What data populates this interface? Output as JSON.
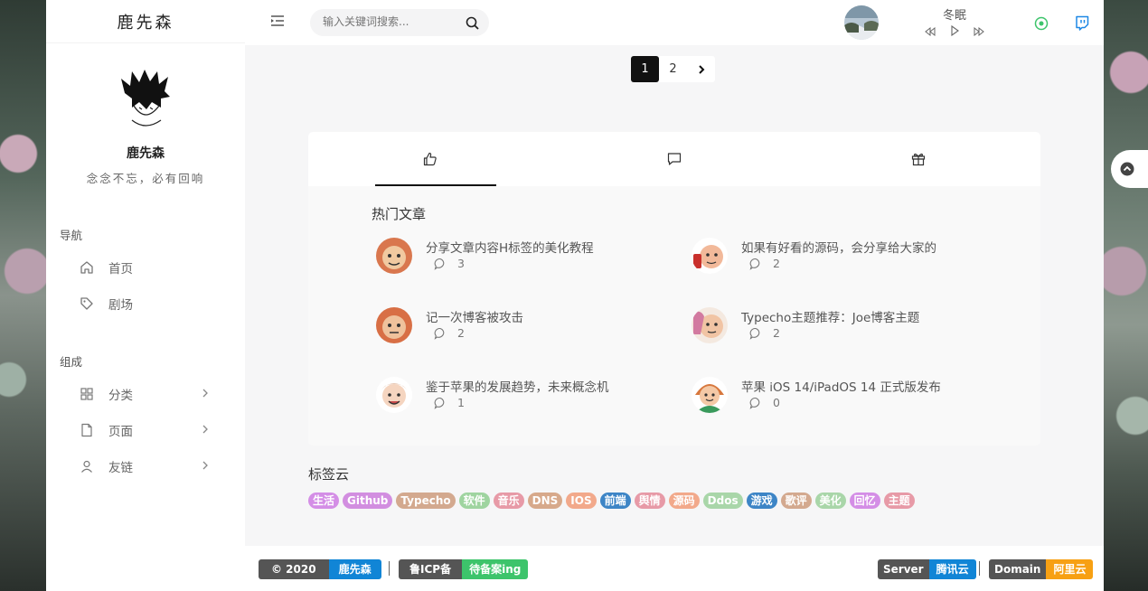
{
  "site": {
    "logo_text": "鹿先森",
    "nickname": "鹿先森",
    "motto": "念念不忘，必有回响"
  },
  "nav": {
    "section1": "导航",
    "section2": "组成",
    "items": [
      {
        "label": "首页",
        "icon": "home-icon"
      },
      {
        "label": "剧场",
        "icon": "tag-icon"
      },
      {
        "label": "分类",
        "icon": "grid-icon"
      },
      {
        "label": "页面",
        "icon": "file-icon"
      },
      {
        "label": "友链",
        "icon": "user-icon"
      }
    ]
  },
  "search": {
    "placeholder": "输入关键词搜索..."
  },
  "player": {
    "song": "冬眠"
  },
  "pagination": {
    "pages": [
      "1",
      "2"
    ],
    "current": "1"
  },
  "hot": {
    "title": "热门文章",
    "posts": [
      {
        "title": "分享文章内容H标签的美化教程",
        "comments": "3"
      },
      {
        "title": "如果有好看的源码，会分享给大家的",
        "comments": "2"
      },
      {
        "title": "记一次博客被攻击",
        "comments": "2"
      },
      {
        "title": "Typecho主题推荐：Joe博客主题",
        "comments": "2"
      },
      {
        "title": "鉴于苹果的发展趋势，未来概念机",
        "comments": "1"
      },
      {
        "title": "苹果 iOS 14/iPadOS 14 正式版发布",
        "comments": "0"
      }
    ]
  },
  "tag_cloud": {
    "title": "标签云",
    "tags": [
      {
        "label": "生活",
        "color": "#d48ee6"
      },
      {
        "label": "Github",
        "color": "#d28ee0"
      },
      {
        "label": "Typecho",
        "color": "#d3a98f"
      },
      {
        "label": "软件",
        "color": "#9fd4a0"
      },
      {
        "label": "音乐",
        "color": "#e79aa7"
      },
      {
        "label": "DNS",
        "color": "#d7a98b"
      },
      {
        "label": "IOS",
        "color": "#f2a98b"
      },
      {
        "label": "前端",
        "color": "#3d85c6"
      },
      {
        "label": "舆情",
        "color": "#e79aa7"
      },
      {
        "label": "源码",
        "color": "#f2a98b"
      },
      {
        "label": "Ddos",
        "color": "#a9d6a9"
      },
      {
        "label": "游戏",
        "color": "#3d85c6"
      },
      {
        "label": "歌评",
        "color": "#d3a98f"
      },
      {
        "label": "美化",
        "color": "#a9d6a9"
      },
      {
        "label": "回忆",
        "color": "#d48ee6"
      },
      {
        "label": "主题",
        "color": "#e79aa7"
      }
    ]
  },
  "footer": {
    "copyright_left": "©  2020",
    "copyright_right": "鹿先森",
    "icp_left": "鲁ICP备",
    "icp_right": "待备案ing",
    "server_left": "Server",
    "server_right": "腾讯云",
    "domain_left": "Domain",
    "domain_right": "阿里云"
  },
  "colors": {
    "accent_dark": "#111111",
    "badge_blue": "#1185d6",
    "badge_green": "#3dc46b",
    "badge_orange": "#f7a013",
    "badge_gray": "#555555"
  }
}
